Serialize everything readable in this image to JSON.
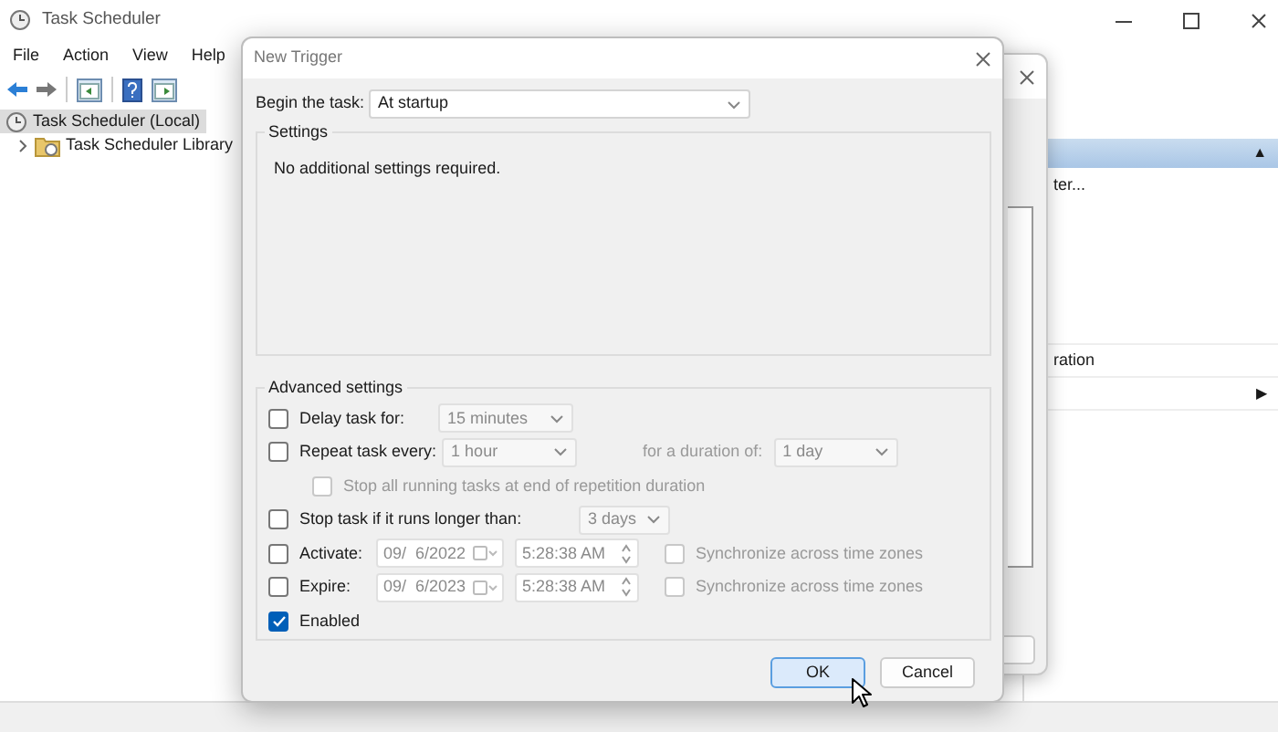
{
  "main_window": {
    "title": "Task Scheduler",
    "menu": [
      "File",
      "Action",
      "View",
      "Help"
    ],
    "tree": [
      {
        "label": "Task Scheduler (Local)",
        "selected": true,
        "children": [
          {
            "label": "Task Scheduler Library",
            "selected": false,
            "expanded": false
          }
        ]
      }
    ],
    "actions": {
      "collapse_glyph": "▲",
      "items": [
        {
          "kind": "text",
          "text": "ter..."
        },
        {
          "kind": "text",
          "text": "ration"
        },
        {
          "kind": "arrow",
          "text": "▶"
        }
      ]
    }
  },
  "dialog": {
    "title": "New Trigger",
    "begin_label": "Begin the task:",
    "begin_value": "At startup",
    "settings": {
      "title": "Settings",
      "message": "No additional settings required."
    },
    "advanced": {
      "title": "Advanced settings",
      "rows": [
        {
          "kind": "select",
          "label": "Delay task for:",
          "checked": false,
          "value": "15 minutes"
        },
        {
          "kind": "repeat",
          "label": "Repeat task every:",
          "checked": false,
          "value": "1 hour",
          "duration_label": "for a duration of:",
          "duration_value": "1 day"
        },
        {
          "kind": "subcheck",
          "label": "Stop all running tasks at end of repetition duration",
          "checked": false
        },
        {
          "kind": "select",
          "label": "Stop task if it runs longer than:",
          "checked": false,
          "value": "3 days"
        },
        {
          "kind": "datetime",
          "label": "Activate:",
          "checked": false,
          "date": "09/  6/2022",
          "time": "5:28:38 AM",
          "sync_label": "Synchronize across time zones",
          "sync_checked": false
        },
        {
          "kind": "datetime",
          "label": "Expire:",
          "checked": false,
          "date": "09/  6/2023",
          "time": "5:28:38 AM",
          "sync_label": "Synchronize across time zones",
          "sync_checked": false
        },
        {
          "kind": "check",
          "label": "Enabled",
          "checked": true
        }
      ]
    },
    "buttons": [
      {
        "label": "OK",
        "default": true
      },
      {
        "label": "Cancel",
        "default": false
      }
    ]
  }
}
